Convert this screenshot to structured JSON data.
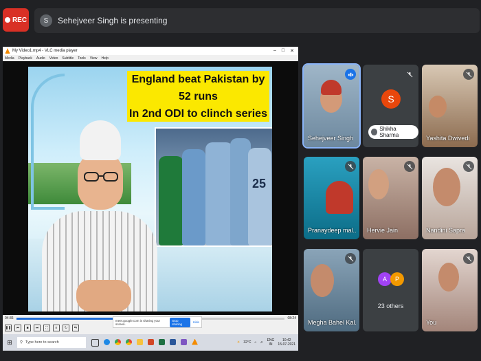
{
  "meeting": {
    "rec_label": "REC",
    "presenter_initial": "S",
    "presenting_text": "Sehejveer Singh is presenting"
  },
  "vlc": {
    "title": "My Video1.mp4 - VLC media player",
    "menu": [
      "Media",
      "Playback",
      "Audio",
      "Video",
      "Subtitle",
      "Tools",
      "View",
      "Help"
    ],
    "time_elapsed": "04:36",
    "time_total": "08:24",
    "progress": 0.38,
    "headline_line1": "England beat Pakistan by 52 runs",
    "headline_line2": "In 2nd ODI to clinch series",
    "jersey_number": "25"
  },
  "share_notice": {
    "text": "meet.google.com is sharing your screen.",
    "stop_label": "Stop sharing",
    "hide_label": "Hide"
  },
  "taskbar": {
    "search_placeholder": "Type here to search",
    "weather": "32°C",
    "lang": "ENG",
    "region": "IN",
    "time": "10:42",
    "date": "15-07-2021"
  },
  "participants": [
    {
      "name": "Sehejveer Singh",
      "state": "speaking"
    },
    {
      "name": "Shikha Sharma",
      "initial": "S",
      "avatar_color": "#e8470c",
      "state": "muted"
    },
    {
      "name": "Yashita Dwivedi",
      "state": "muted"
    },
    {
      "name": "Pranaydeep mal...",
      "state": "muted"
    },
    {
      "name": "Hervie Jain",
      "state": "muted"
    },
    {
      "name": "Nandini Sapra",
      "state": "muted"
    },
    {
      "name": "Megha Bahel Kal...",
      "state": "muted"
    },
    {
      "name": "23 others",
      "initials": [
        "A",
        "P"
      ],
      "colors": [
        "#a142f4",
        "#f29900"
      ]
    },
    {
      "name": "You",
      "state": "muted"
    }
  ]
}
